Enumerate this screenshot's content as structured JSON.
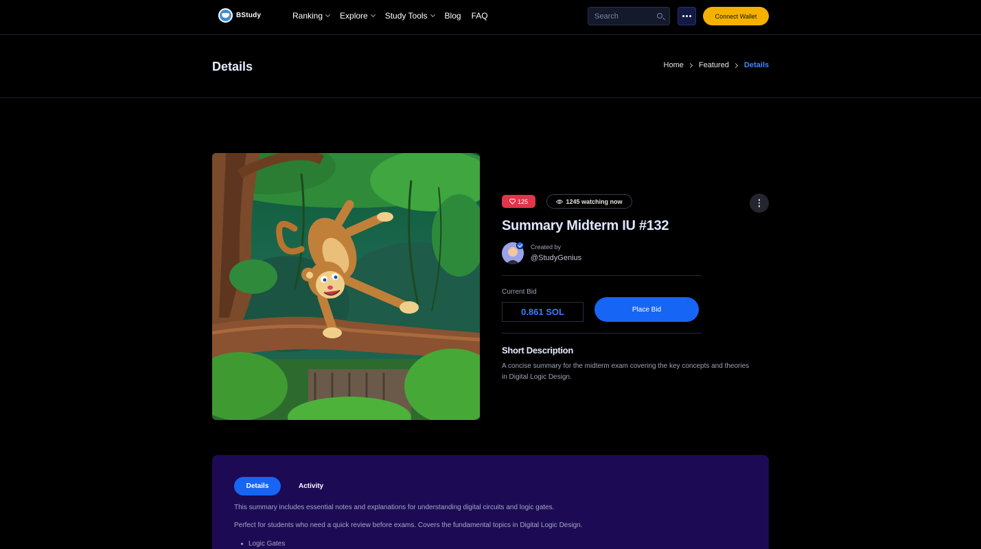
{
  "header": {
    "logo_text": "BStudy",
    "nav": [
      {
        "label": "Ranking",
        "has_dropdown": true
      },
      {
        "label": "Explore",
        "has_dropdown": true
      },
      {
        "label": "Study Tools",
        "has_dropdown": true
      },
      {
        "label": "Blog",
        "has_dropdown": false
      },
      {
        "label": "FAQ",
        "has_dropdown": false
      }
    ],
    "search_placeholder": "Search",
    "connect_wallet": "Connect Wallet"
  },
  "title_bar": {
    "title": "Details",
    "breadcrumb": [
      "Home",
      "Featured",
      "Details"
    ]
  },
  "item": {
    "likes": "125",
    "watching": "1245 watching now",
    "title": "Summary Midterm IU #132",
    "created_by_label": "Created by",
    "creator": "@StudyGenius",
    "current_bid_label": "Current Bid",
    "current_bid": "0.861 SOL",
    "place_bid": "Place Bid",
    "short_description_title": "Short Description",
    "short_description": "A concise summary for the midterm exam covering the key concepts and theories in Digital Logic Design."
  },
  "tabs": {
    "items": [
      "Details",
      "Activity"
    ],
    "active": "Details",
    "paragraphs": [
      "This summary includes essential notes and explanations for understanding digital circuits and logic gates.",
      "Perfect for students who need a quick review before exams. Covers the fundamental topics in Digital Logic Design."
    ],
    "list": [
      "Logic Gates"
    ]
  },
  "colors": {
    "background": "#000000",
    "accent_blue": "#1765f4",
    "wallet_yellow": "#f5b100",
    "like_red": "#e2344a",
    "panel_purple": "#1d0a55"
  },
  "icons": [
    "logo-icon",
    "chevron-down-icon",
    "search-icon",
    "more-horizontal-icon",
    "chevron-right-icon",
    "heart-icon",
    "eye-icon",
    "more-vertical-icon",
    "verified-icon"
  ]
}
